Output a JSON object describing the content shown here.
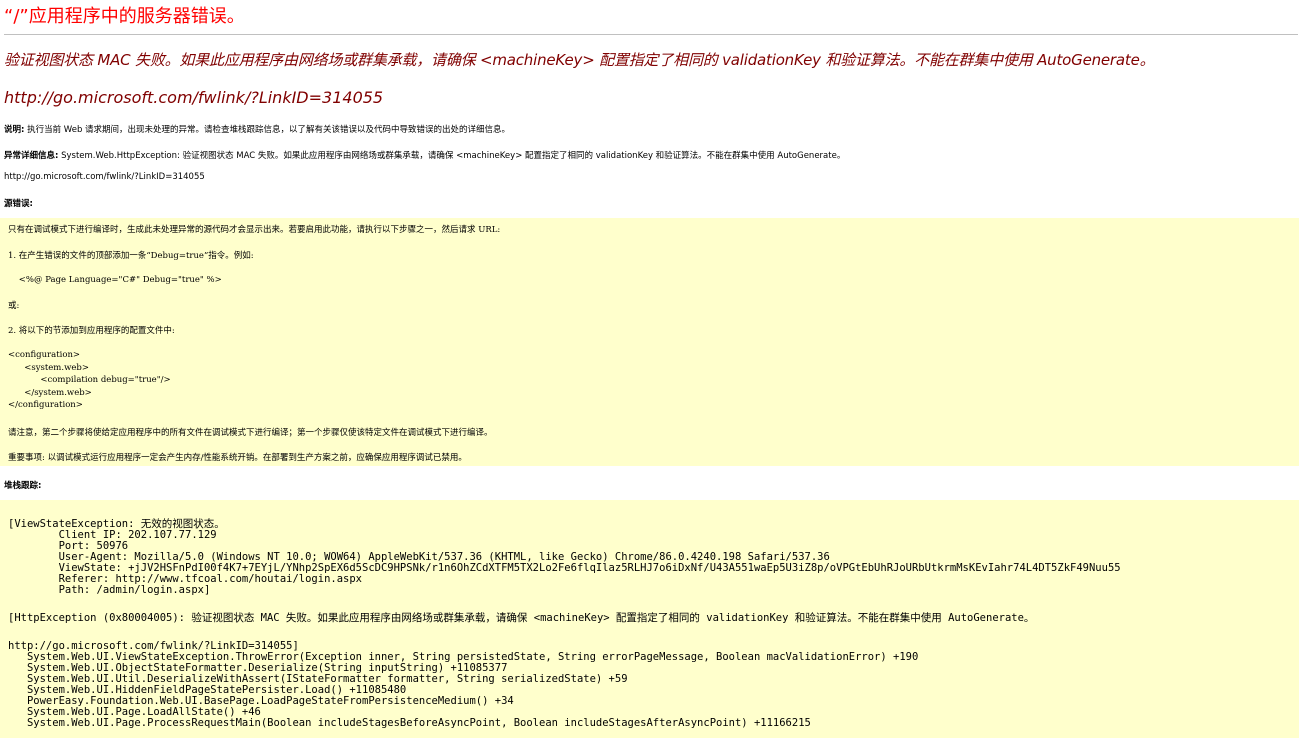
{
  "page_title": "“/”应用程序中的服务器错误。",
  "error_message": "验证视图状态 MAC 失败。如果此应用程序由网络场或群集承载，请确保 <machineKey> 配置指定了相同的 validationKey 和验证算法。不能在群集中使用 AutoGenerate。",
  "error_link": "http://go.microsoft.com/fwlink/?LinkID=314055",
  "description": {
    "label": "说明:",
    "text": " 执行当前 Web 请求期间，出现未处理的异常。请检查堆栈跟踪信息，以了解有关该错误以及代码中导致错误的出处的详细信息。"
  },
  "exception_details": {
    "label": "异常详细信息:",
    "text": " System.Web.HttpException: 验证视图状态 MAC 失败。如果此应用程序由网络场或群集承载，请确保 <machineKey> 配置指定了相同的 validationKey 和验证算法。不能在群集中使用 AutoGenerate。"
  },
  "details_link": "http://go.microsoft.com/fwlink/?LinkID=314055",
  "source_error": {
    "label": "源错误:",
    "lines": [
      "只有在调试模式下进行编译时，生成此未处理异常的源代码才会显示出来。若要启用此功能，请执行以下步骤之一，然后请求 URL:",
      "1. 在产生错误的文件的顶部添加一条“Debug=true”指令。例如:",
      "    <%@ Page Language=\"C#\" Debug=\"true\" %>",
      "或:",
      "2. 将以下的节添加到应用程序的配置文件中:",
      "<configuration>",
      "      <system.web>",
      "            <compilation debug=\"true\"/>",
      "      </system.web>",
      "</configuration>",
      "请注意，第二个步骤将使给定应用程序中的所有文件在调试模式下进行编译；第一个步骤仅使该特定文件在调试模式下进行编译。",
      "重要事项: 以调试模式运行应用程序一定会产生内存/性能系统开销。在部署到生产方案之前，应确保应用程序调试已禁用。"
    ]
  },
  "stack_trace": {
    "label": "堆栈跟踪:",
    "lines": [
      "[ViewStateException: 无效的视图状态。",
      "        Client IP: 202.107.77.129",
      "        Port: 50976",
      "        User-Agent: Mozilla/5.0 (Windows NT 10.0; WOW64) AppleWebKit/537.36 (KHTML, like Gecko) Chrome/86.0.4240.198 Safari/537.36",
      "        ViewState: +jJV2HSFnPdI00f4K7+7EYjL/YNhp2SpEX6d5ScDC9HPSNk/r1n6OhZCdXTFM5TX2Lo2Fe6flqIlaz5RLHJ7o6iDxNf/U43A551waEp5U3iZ8p/oVPGtEbUhRJoURbUtkrmMsKEvIahr74L4DT5ZkF49Nuu55",
      "        Referer: http://www.tfcoal.com/houtai/login.aspx",
      "        Path: /admin/login.aspx]",
      "[HttpException (0x80004005): 验证视图状态 MAC 失败。如果此应用程序由网络场或群集承载，请确保 <machineKey> 配置指定了相同的 validationKey 和验证算法。不能在群集中使用 AutoGenerate。",
      "http://go.microsoft.com/fwlink/?LinkID=314055]",
      "   System.Web.UI.ViewStateException.ThrowError(Exception inner, String persistedState, String errorPageMessage, Boolean macValidationError) +190",
      "   System.Web.UI.ObjectStateFormatter.Deserialize(String inputString) +11085377",
      "   System.Web.UI.Util.DeserializeWithAssert(IStateFormatter formatter, String serializedState) +59",
      "   System.Web.UI.HiddenFieldPageStatePersister.Load() +11085480",
      "   PowerEasy.Foundation.Web.UI.BasePage.LoadPageStateFromPersistenceMedium() +34",
      "   System.Web.UI.Page.LoadAllState() +46",
      "   System.Web.UI.Page.ProcessRequestMain(Boolean includeStagesBeforeAsyncPoint, Boolean includeStagesAfterAsyncPoint) +11166215"
    ]
  }
}
